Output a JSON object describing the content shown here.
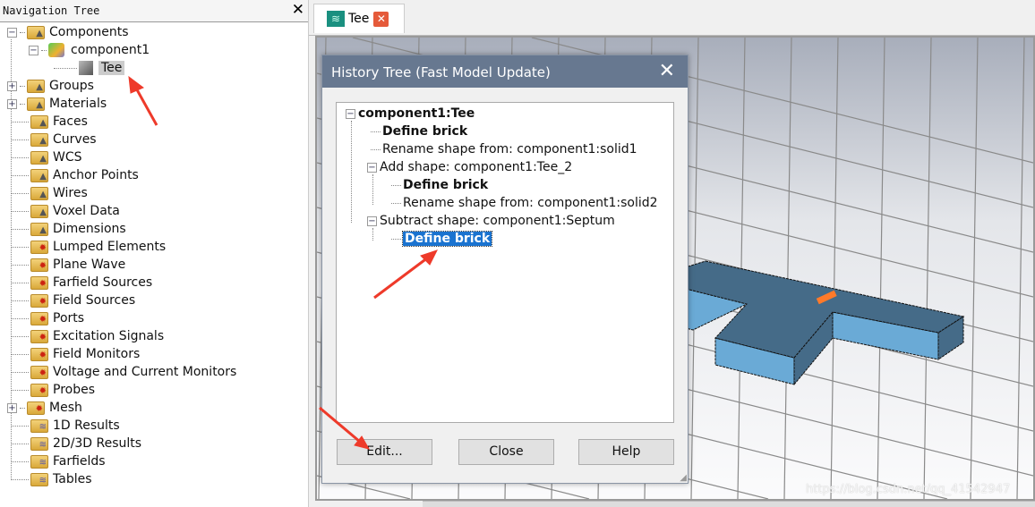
{
  "nav": {
    "title": "Navigation Tree",
    "items": [
      {
        "label": "Components",
        "icon": "folder-cone-icon",
        "toggle": "−"
      },
      {
        "label": "component1",
        "icon": "component-icon",
        "toggle": "−"
      },
      {
        "label": "Tee",
        "icon": "solid-shape-icon"
      },
      {
        "label": "Groups",
        "icon": "folder-cone-icon",
        "toggle": "+"
      },
      {
        "label": "Materials",
        "icon": "folder-cone-icon",
        "toggle": "+"
      },
      {
        "label": "Faces",
        "icon": "folder-cone-icon"
      },
      {
        "label": "Curves",
        "icon": "folder-cone-icon"
      },
      {
        "label": "WCS",
        "icon": "folder-cone-icon"
      },
      {
        "label": "Anchor Points",
        "icon": "folder-cone-icon"
      },
      {
        "label": "Wires",
        "icon": "folder-cone-icon"
      },
      {
        "label": "Voxel Data",
        "icon": "folder-cone-icon"
      },
      {
        "label": "Dimensions",
        "icon": "folder-cone-icon"
      },
      {
        "label": "Lumped Elements",
        "icon": "folder-gear-icon"
      },
      {
        "label": "Plane Wave",
        "icon": "folder-gear-icon"
      },
      {
        "label": "Farfield Sources",
        "icon": "folder-gear-icon"
      },
      {
        "label": "Field Sources",
        "icon": "folder-gear-icon"
      },
      {
        "label": "Ports",
        "icon": "folder-gear-icon"
      },
      {
        "label": "Excitation Signals",
        "icon": "folder-gear-icon"
      },
      {
        "label": "Field Monitors",
        "icon": "folder-gear-icon"
      },
      {
        "label": "Voltage and Current Monitors",
        "icon": "folder-gear-icon"
      },
      {
        "label": "Probes",
        "icon": "folder-gear-icon"
      },
      {
        "label": "Mesh",
        "icon": "folder-gear-icon",
        "toggle": "+"
      },
      {
        "label": "1D Results",
        "icon": "folder-wave-icon"
      },
      {
        "label": "2D/3D Results",
        "icon": "folder-wave-icon"
      },
      {
        "label": "Farfields",
        "icon": "folder-wave-icon"
      },
      {
        "label": "Tables",
        "icon": "folder-wave-icon"
      }
    ]
  },
  "tab": {
    "label": "Tee",
    "icon": "wave-icon"
  },
  "dialog": {
    "title": "History Tree (Fast Model Update)",
    "items": [
      {
        "label": "component1:Tee",
        "level": 0,
        "bold": true,
        "toggle": "−"
      },
      {
        "label": "Define brick",
        "level": 1,
        "bold": true
      },
      {
        "label": "Rename shape from: component1:solid1",
        "level": 1
      },
      {
        "label": "Add shape: component1:Tee_2",
        "level": 1,
        "toggle": "−"
      },
      {
        "label": "Define brick",
        "level": 2,
        "bold": true
      },
      {
        "label": "Rename shape from: component1:solid2",
        "level": 2
      },
      {
        "label": "Subtract shape: component1:Septum",
        "level": 1,
        "toggle": "−"
      },
      {
        "label": "Define brick",
        "level": 2,
        "bold": true,
        "selected": true
      }
    ],
    "buttons": {
      "edit": "Edit...",
      "close": "Close",
      "help": "Help"
    }
  },
  "watermark": "https://blog.csdn.net/qq_41542947",
  "colors": {
    "titlebar": "#677890",
    "selection": "#1a73d0",
    "model_top": "#456b88",
    "model_side": "#6aaad6",
    "annotation_arrow": "#ee3a2a"
  }
}
